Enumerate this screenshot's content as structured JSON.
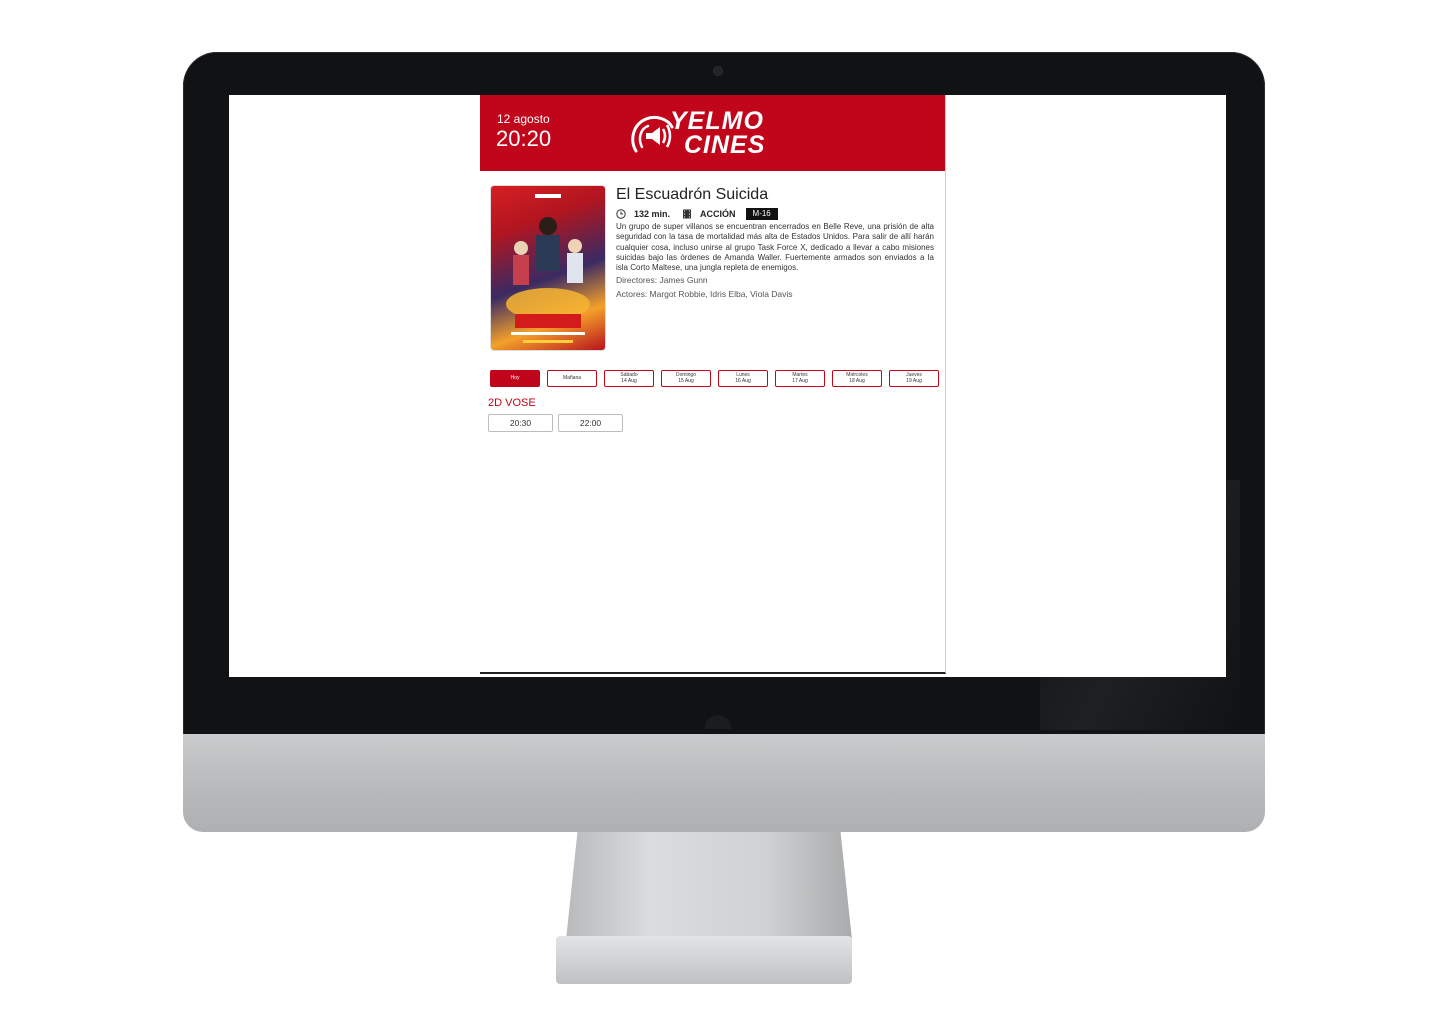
{
  "header": {
    "date": "12 agosto",
    "time": "20:20",
    "brand_line1": "YELMO",
    "brand_line2": "CINES",
    "color": "#c1051a"
  },
  "movie": {
    "title": "El Escuadrón Suicida",
    "duration": "132 min.",
    "genre": "ACCIÓN",
    "rating": "M-16",
    "synopsis": "Un grupo de super villanos se encuentran encerrados en Belle Reve, una prisión de alta seguridad con la tasa de mortalidad más alta de Estados Unidos. Para salir de allí harán cualquier cosa, incluso unirse al grupo Task Force X, dedicado a llevar a cabo misiones suicidas bajo las órdenes de Amanda Waller. Fuertemente armados son enviados a la isla Corto Maltese, una jungla repleta de enemigos.",
    "directors": "Directores: James Gunn",
    "actors": "Actores: Margot Robbie, Idris Elba, Viola Davis",
    "poster_icon": "movie-poster-image"
  },
  "days": [
    {
      "label": "Hoy",
      "date": ""
    },
    {
      "label": "Mañana",
      "date": ""
    },
    {
      "label": "Sábado",
      "date": "14 Aug"
    },
    {
      "label": "Domingo",
      "date": "15 Aug"
    },
    {
      "label": "Lunes",
      "date": "16 Aug"
    },
    {
      "label": "Martes",
      "date": "17 Aug"
    },
    {
      "label": "Miércoles",
      "date": "18 Aug"
    },
    {
      "label": "Jueves",
      "date": "19 Aug"
    }
  ],
  "selected_day": "Hoy",
  "format": "2D VOSE",
  "sessions": [
    "20:30",
    "22:00"
  ]
}
